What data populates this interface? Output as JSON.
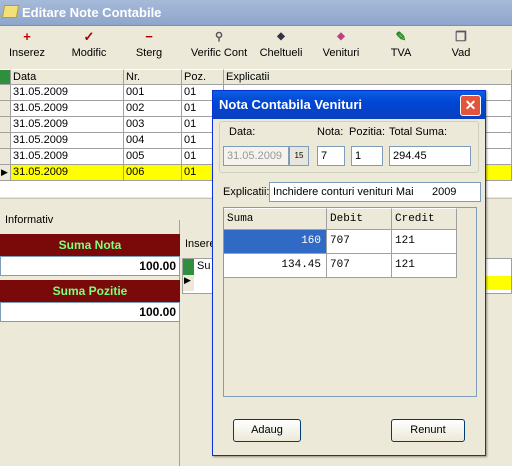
{
  "window": {
    "title": "Editare Note Contabile"
  },
  "toolbar": {
    "items": [
      {
        "label": "Inserez",
        "icon": "+"
      },
      {
        "label": "Modific",
        "icon": "✓"
      },
      {
        "label": "Sterg",
        "icon": "−"
      },
      {
        "label": "Verific Cont",
        "icon": "⚲"
      },
      {
        "label": "Cheltueli",
        "icon": "◆"
      },
      {
        "label": "Venituri",
        "icon": "◆"
      },
      {
        "label": "TVA",
        "icon": "✎"
      },
      {
        "label": "Vad",
        "icon": "❐"
      }
    ]
  },
  "grid": {
    "headers": [
      "Data",
      "Nr.",
      "Poz.",
      "Explicatii"
    ],
    "rows": [
      [
        "31.05.2009",
        "001",
        "01",
        ""
      ],
      [
        "31.05.2009",
        "002",
        "01",
        ""
      ],
      [
        "31.05.2009",
        "003",
        "01",
        ""
      ],
      [
        "31.05.2009",
        "004",
        "01",
        ""
      ],
      [
        "31.05.2009",
        "005",
        "01",
        ""
      ],
      [
        "31.05.2009",
        "006",
        "01",
        ""
      ]
    ]
  },
  "informativ": {
    "group_label": "Informativ",
    "suma_nota_label": "Suma Nota",
    "suma_nota_value": "100.00",
    "suma_pozitie_label": "Suma Pozitie",
    "suma_pozitie_value": "100.00"
  },
  "lower_grid": {
    "insert_label": "Insere",
    "header_su": "Su"
  },
  "dialog": {
    "title": "Nota Contabila Venituri",
    "data_label": "Data:",
    "data_value": "31.05.2009",
    "nota_label": "Nota:",
    "nota_value": "7",
    "pozitia_label": "Pozitia:",
    "pozitia_value": "1",
    "total_label": "Total Suma:",
    "total_value": "294.45",
    "explicatii_label": "Explicatii:",
    "explicatii_value": "Inchidere conturi venituri Mai      2009",
    "table": {
      "headers": [
        "Suma",
        "Debit",
        "Credit"
      ],
      "rows": [
        [
          "160",
          "707",
          "121"
        ],
        [
          "134.45",
          "707",
          "121"
        ]
      ]
    },
    "adaug_label": "Adaug",
    "renunt_label": "Renunt"
  },
  "colors": {
    "selected_row": "#ffff00",
    "title_active": "#0046d5",
    "red_panel": "#7a0a0a",
    "green_text": "#7dff7d"
  }
}
